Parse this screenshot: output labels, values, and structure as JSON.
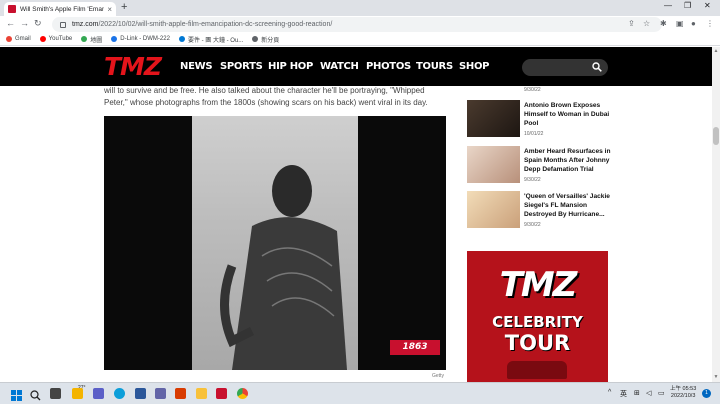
{
  "browser": {
    "tab_title": "Will Smith's Apple Film 'Emanc...",
    "tab_close": "×",
    "new_tab": "+",
    "url_host": "tmz.com",
    "url_path": "/2022/10/02/will-smith-apple-film-emancipation-dc-screening-good-reaction/",
    "bookmarks": [
      {
        "label": "Gmail",
        "color": "#ea4335"
      },
      {
        "label": "YouTube",
        "color": "#ff0000"
      },
      {
        "label": "地圖",
        "color": "#34a853"
      },
      {
        "label": "D-Link - DWM-222",
        "color": "#1a73e8"
      },
      {
        "label": "要件 - 團 大鐘 - Ou...",
        "color": "#0078d4"
      },
      {
        "label": "新分頁",
        "color": "#5f6368"
      }
    ]
  },
  "tmz": {
    "logo": "TMZ",
    "nav": [
      "NEWS",
      "SPORTS",
      "HIP HOP",
      "WATCH",
      "PHOTOS",
      "TOURS",
      "SHOP"
    ]
  },
  "article": {
    "text_line1": "will to survive and be free. He also talked about the character he'll be portraying, \"Whipped",
    "text_line2": "Peter,\" whose photographs from the 1800s (showing scars on his back) went viral in its day.",
    "photo_year": "1863",
    "photo_credit": "Getty"
  },
  "sidebar": {
    "top_date": "9/30/22",
    "items": [
      {
        "title": "Antonio Brown Exposes Himself to Woman in Dubai Pool",
        "date": "10/01/22"
      },
      {
        "title": "Amber Heard Resurfaces in Spain Months After Johnny Depp Defamation Trial",
        "date": "9/30/22"
      },
      {
        "title": "'Queen of Versailles' Jackie Siegel's FL Mansion Destroyed By Hurricane...",
        "date": "9/30/22"
      }
    ],
    "ad": {
      "logo": "TMZ",
      "line1": "CELEBRITY",
      "line2": "TOUR"
    }
  },
  "taskbar": {
    "weather_temp": "27°",
    "tray_lang": "英",
    "time": "上午 05:53",
    "date": "2022/10/3",
    "notifications": "1"
  }
}
